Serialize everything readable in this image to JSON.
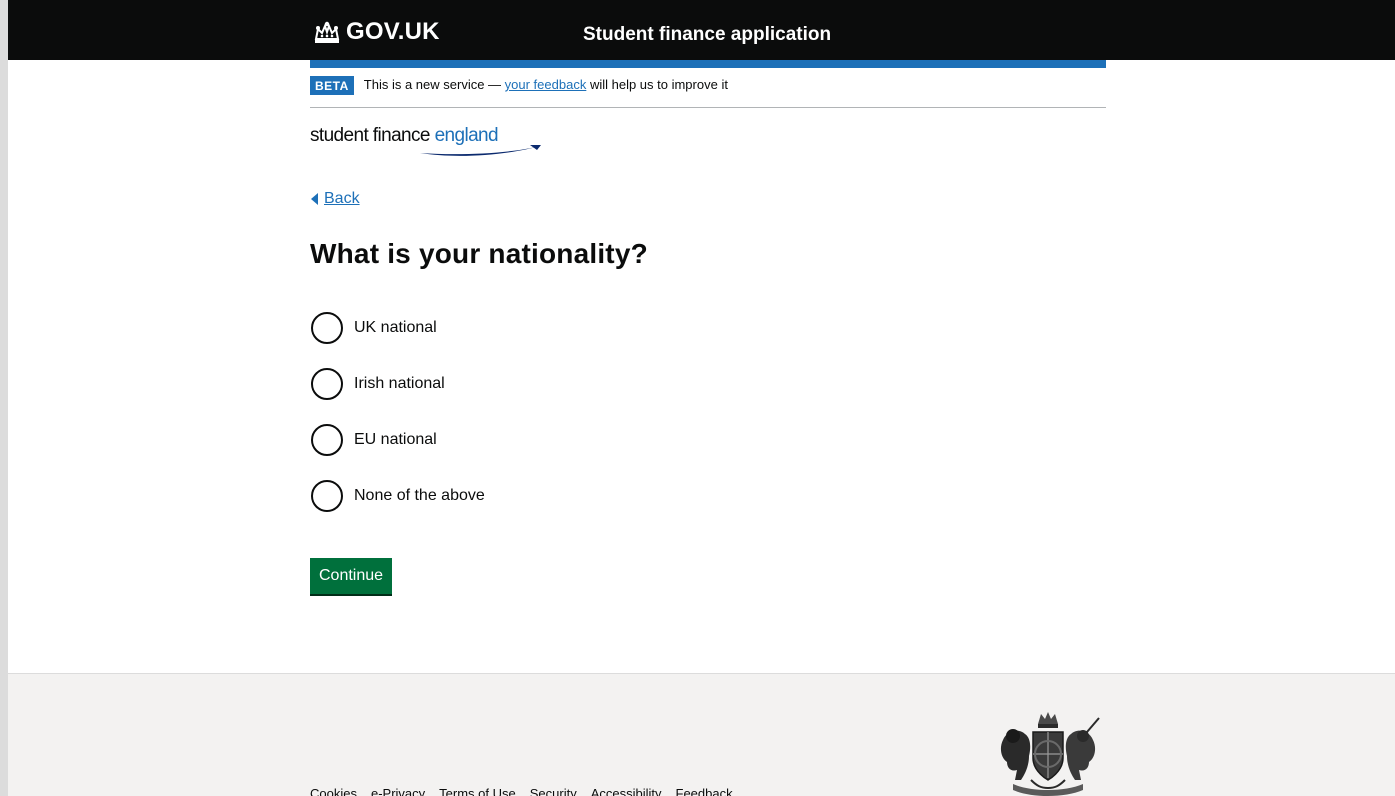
{
  "header": {
    "logo_text": "GOV.UK",
    "service_name": "Student finance application"
  },
  "phase_banner": {
    "tag": "BETA",
    "text_before": "This is a new service — ",
    "link_text": "your feedback",
    "text_after": " will help us to improve it"
  },
  "brand": {
    "part1": "student finance ",
    "part2": "england"
  },
  "back_link": "Back",
  "question": {
    "title": "What is your nationality?",
    "options": [
      {
        "label": "UK national"
      },
      {
        "label": "Irish national"
      },
      {
        "label": "EU national"
      },
      {
        "label": "None of the above"
      }
    ]
  },
  "continue_label": "Continue",
  "footer": {
    "links": [
      "Cookies",
      "e-Privacy",
      "Terms of Use",
      "Security",
      "Accessibility",
      "Feedback"
    ]
  },
  "colors": {
    "header_bg": "#0b0c0c",
    "brand_blue": "#1d70b8",
    "button_green": "#00703c",
    "footer_bg": "#f3f2f1"
  }
}
